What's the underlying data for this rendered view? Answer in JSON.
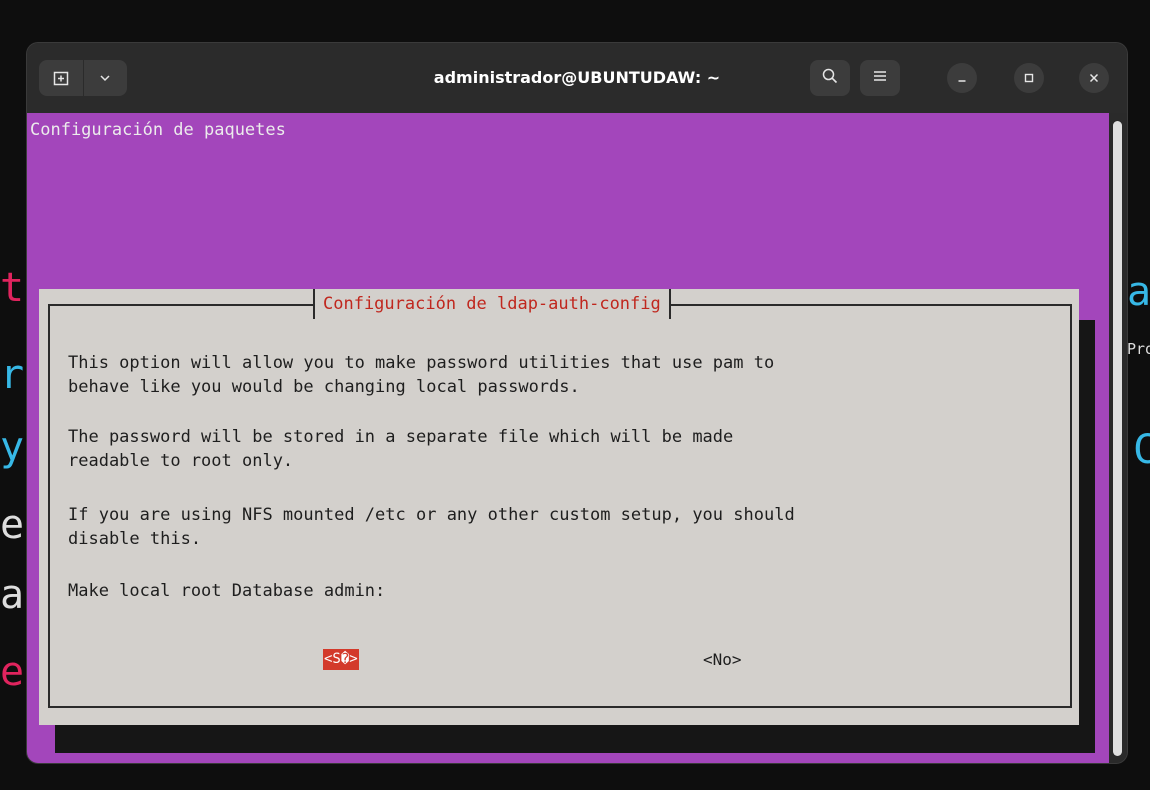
{
  "window": {
    "title": "administrador@UBUNTUDAW: ~"
  },
  "terminal": {
    "header": "Configuración de paquetes",
    "dialog": {
      "title": "Configuración de ldap-auth-config",
      "paragraphs": [
        "This option will allow you to make password utilities that use pam to",
        "behave like you would be changing local passwords.",
        "The password will be stored in a separate file which will be made",
        "readable to root only.",
        "If you are using NFS mounted /etc or any other custom setup, you should",
        "disable this.",
        "Make local root Database admin:"
      ],
      "yes_label": "<S�>",
      "no_label": "<No>"
    }
  },
  "background": {
    "left_glyphs": [
      "t",
      "r",
      "y",
      "e",
      "a",
      "e"
    ],
    "right_glyphs": [
      "a",
      "Pro",
      "C"
    ]
  },
  "colors": {
    "terminal_bg": "#a346bb",
    "dialog_bg": "#d3d0cc",
    "dialog_title": "#c0271e",
    "selected_button": "#d33a2b"
  },
  "icons": {
    "new_tab": "new-tab-icon",
    "menu_dropdown": "chevron-down-icon",
    "search": "search-icon",
    "hamburger": "hamburger-menu-icon",
    "minimize": "minimize-icon",
    "maximize": "maximize-icon",
    "close": "close-icon"
  }
}
